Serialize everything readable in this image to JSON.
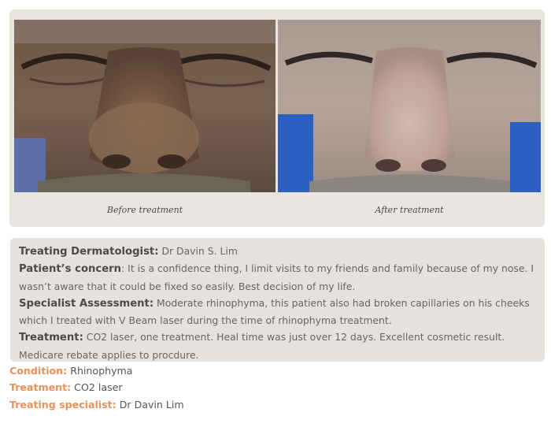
{
  "gallery": {
    "before_caption": "Before treatment",
    "after_caption": "After treatment"
  },
  "details": {
    "dermatologist": {
      "label": "Treating Dermatologist:",
      "value": " Dr Davin S. Lim"
    },
    "concern": {
      "label": "Patient’s concern",
      "value": ": It is a confidence thing, I limit visits to my friends and family because of my nose. I wasn’t aware that it could be fixed so easily. Best decision of my life."
    },
    "assessment": {
      "label": "Specialist Assessment:",
      "value": " Moderate rhinophyma, this patient also had broken capillaries on his cheeks which I treated with V Beam laser during the time of rhinophyma treatment."
    },
    "treatment": {
      "label": "Treatment:",
      "value": " CO2 laser, one treatment. Heal time was just over 12 days. Excellent cosmetic result. Medicare rebate applies to procdure."
    }
  },
  "summary": {
    "condition": {
      "label": "Condition:",
      "value": " Rhinophyma"
    },
    "treatment": {
      "label": "Treatment:",
      "value": " CO2 laser"
    },
    "specialist": {
      "label": "Treating specialist:",
      "value": " Dr Davin Lim"
    }
  },
  "colors": {
    "panel_bg": "#e9e5e1",
    "accent_orange": "#e8915a",
    "label_text": "#4a4a4a",
    "body_text": "#666666"
  }
}
